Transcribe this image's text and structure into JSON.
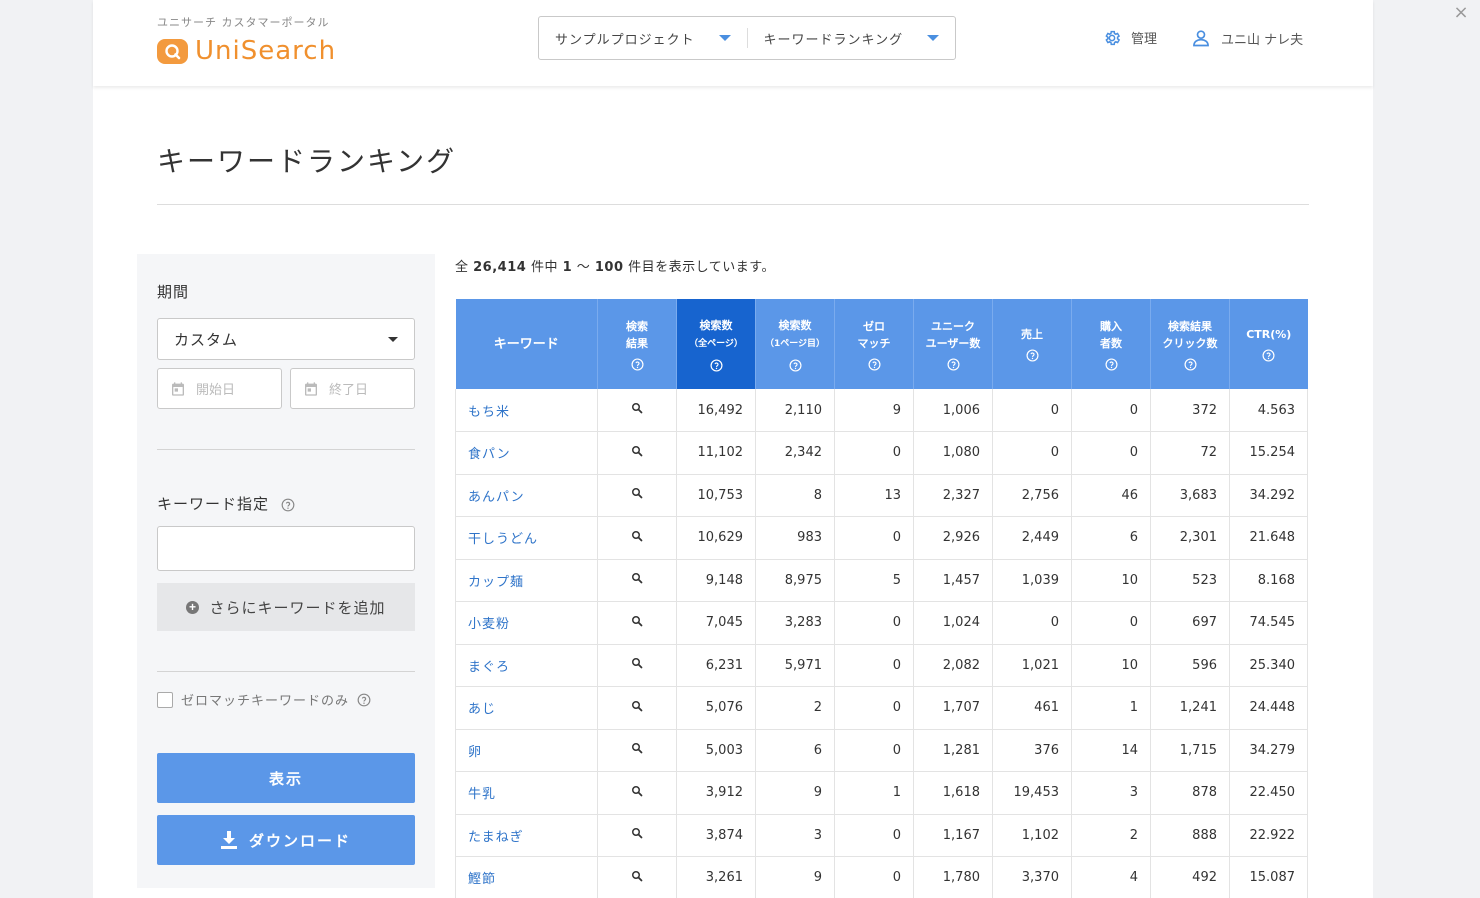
{
  "window": {
    "close_label": "×"
  },
  "header": {
    "brand_sub": "ユニサーチ カスタマーポータル",
    "brand_name": "UniSearch",
    "project_select": "サンプルプロジェクト",
    "report_select": "キーワードランキング",
    "admin_label": "管理",
    "user_name": "ユニ山 ナレ夫"
  },
  "page": {
    "title": "キーワードランキング"
  },
  "sidebar": {
    "period_label": "期間",
    "period_value": "カスタム",
    "start_placeholder": "開始日",
    "end_placeholder": "終了日",
    "keyword_label": "キーワード指定",
    "keyword_value": "",
    "add_keyword_label": "さらにキーワードを追加",
    "zero_match_label": "ゼロマッチキーワードのみ",
    "show_button": "表示",
    "download_button": "ダウンロード"
  },
  "summary": {
    "prefix": "全 ",
    "total": "26,414",
    "mid1": " 件中 ",
    "from": "1",
    "tilde": " 〜 ",
    "to": "100",
    "suffix": " 件目を表示しています。"
  },
  "table": {
    "headers": [
      {
        "line1": "キーワード",
        "line2": ""
      },
      {
        "line1": "検索",
        "line2": "結果"
      },
      {
        "line1": "検索数",
        "line2": "（全ページ）"
      },
      {
        "line1": "検索数",
        "line2": "（1ページ目）"
      },
      {
        "line1": "ゼロ",
        "line2": "マッチ"
      },
      {
        "line1": "ユニーク",
        "line2": "ユーザー数"
      },
      {
        "line1": "売上",
        "line2": ""
      },
      {
        "line1": "購入",
        "line2": "者数"
      },
      {
        "line1": "検索結果",
        "line2": "クリック数"
      },
      {
        "line1": "CTR(%)",
        "line2": ""
      }
    ],
    "rows": [
      {
        "keyword": "もち米",
        "all": "16,492",
        "p1": "2,110",
        "zero": "9",
        "users": "1,006",
        "sales": "0",
        "buyers": "0",
        "clicks": "372",
        "ctr": "4.563"
      },
      {
        "keyword": "食パン",
        "all": "11,102",
        "p1": "2,342",
        "zero": "0",
        "users": "1,080",
        "sales": "0",
        "buyers": "0",
        "clicks": "72",
        "ctr": "15.254"
      },
      {
        "keyword": "あんパン",
        "all": "10,753",
        "p1": "8",
        "zero": "13",
        "users": "2,327",
        "sales": "2,756",
        "buyers": "46",
        "clicks": "3,683",
        "ctr": "34.292"
      },
      {
        "keyword": "干しうどん",
        "all": "10,629",
        "p1": "983",
        "zero": "0",
        "users": "2,926",
        "sales": "2,449",
        "buyers": "6",
        "clicks": "2,301",
        "ctr": "21.648"
      },
      {
        "keyword": "カップ麺",
        "all": "9,148",
        "p1": "8,975",
        "zero": "5",
        "users": "1,457",
        "sales": "1,039",
        "buyers": "10",
        "clicks": "523",
        "ctr": "8.168"
      },
      {
        "keyword": "小麦粉",
        "all": "7,045",
        "p1": "3,283",
        "zero": "0",
        "users": "1,024",
        "sales": "0",
        "buyers": "0",
        "clicks": "697",
        "ctr": "74.545"
      },
      {
        "keyword": "まぐろ",
        "all": "6,231",
        "p1": "5,971",
        "zero": "0",
        "users": "2,082",
        "sales": "1,021",
        "buyers": "10",
        "clicks": "596",
        "ctr": "25.340"
      },
      {
        "keyword": "あじ",
        "all": "5,076",
        "p1": "2",
        "zero": "0",
        "users": "1,707",
        "sales": "461",
        "buyers": "1",
        "clicks": "1,241",
        "ctr": "24.448"
      },
      {
        "keyword": "卵",
        "all": "5,003",
        "p1": "6",
        "zero": "0",
        "users": "1,281",
        "sales": "376",
        "buyers": "14",
        "clicks": "1,715",
        "ctr": "34.279"
      },
      {
        "keyword": "牛乳",
        "all": "3,912",
        "p1": "9",
        "zero": "1",
        "users": "1,618",
        "sales": "19,453",
        "buyers": "3",
        "clicks": "878",
        "ctr": "22.450"
      },
      {
        "keyword": "たまねぎ",
        "all": "3,874",
        "p1": "3",
        "zero": "0",
        "users": "1,167",
        "sales": "1,102",
        "buyers": "2",
        "clicks": "888",
        "ctr": "22.922"
      },
      {
        "keyword": "鰹節",
        "all": "3,261",
        "p1": "9",
        "zero": "0",
        "users": "1,780",
        "sales": "3,370",
        "buyers": "4",
        "clicks": "492",
        "ctr": "15.087"
      }
    ]
  }
}
